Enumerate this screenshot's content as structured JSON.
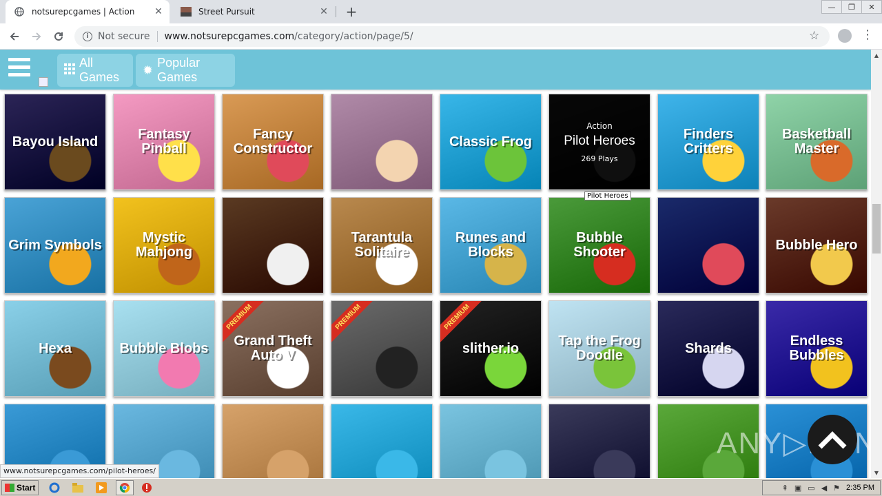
{
  "browser": {
    "tabs": [
      {
        "title": "notsurepcgames | Action",
        "active": true
      },
      {
        "title": "Street Pursuit",
        "active": false
      }
    ],
    "new_tab": "+",
    "close": "✕",
    "window_controls": [
      "—",
      "❐",
      "✕"
    ],
    "security": "Not secure",
    "url_host": "www.notsurepcgames.com",
    "url_path": "/category/action/page/5/",
    "status_url": "www.notsurepcgames.com/pilot-heroes/"
  },
  "site": {
    "nav": {
      "all_games": "All Games",
      "popular_games": "Popular Games"
    },
    "premium_label": "PREMIUM",
    "watermark": "ANY▷RUN",
    "hover": {
      "category": "Action",
      "name": "Pilot Heroes",
      "plays": "269 Plays",
      "tooltip": "Pilot Heroes"
    },
    "games": [
      {
        "name": "",
        "color": "#2ea0d6",
        "accent": "#f2c94c"
      },
      {
        "name": "",
        "color": "#3b3f4a",
        "accent": "#7bd13a"
      },
      {
        "name": "",
        "color": "#a8d67a",
        "accent": "#e8b14a"
      },
      {
        "name": "",
        "color": "#2667c9",
        "accent": "#9b3fd6"
      },
      {
        "name": "",
        "color": "#25b7e0",
        "accent": "#ff9c1a"
      },
      {
        "name": "",
        "color": "#1f8fd6",
        "accent": "#f2c94c"
      },
      {
        "name": "",
        "color": "#c85a2a",
        "accent": "#3a2a1a"
      },
      {
        "name": "",
        "color": "#f4a21e",
        "accent": "#7a3a12"
      },
      {
        "name": "Bayou Island",
        "color": "#2b2456",
        "accent": "#6a4a1e"
      },
      {
        "name": "Fantasy Pinball",
        "color": "#f49ac2",
        "accent": "#ffe04a"
      },
      {
        "name": "Fancy Constructor",
        "color": "#d99a55",
        "accent": "#e04a5a"
      },
      {
        "name": "",
        "color": "#b08aa8",
        "accent": "#f3d4b0"
      },
      {
        "name": "Classic Frog",
        "color": "#38b6e8",
        "accent": "#6cc43a"
      },
      {
        "name": "Pilot Heroes",
        "color": "#2a2a2a",
        "accent": "#555"
      },
      {
        "name": "Finders Critters",
        "color": "#3fb4ea",
        "accent": "#ffd23a"
      },
      {
        "name": "Basketball Master",
        "color": "#8fd3a8",
        "accent": "#d96a2a"
      },
      {
        "name": "Grim Symbols",
        "color": "#4aa3d6",
        "accent": "#f2a81e"
      },
      {
        "name": "Mystic Mahjong",
        "color": "#f2c21e",
        "accent": "#c0651a"
      },
      {
        "name": "",
        "color": "#5a3a22",
        "accent": "#f0f0f0"
      },
      {
        "name": "Tarantula Solitaire",
        "color": "#b9894e",
        "accent": "#ffffff"
      },
      {
        "name": "Runes and Blocks",
        "color": "#5ab8e6",
        "accent": "#d6b44a"
      },
      {
        "name": "Bubble Shooter",
        "color": "#4a9a3a",
        "accent": "#d62d20"
      },
      {
        "name": "",
        "color": "#1a2a6a",
        "accent": "#e04a5a"
      },
      {
        "name": "Bubble Hero",
        "color": "#6a3a2a",
        "accent": "#f2c94c"
      },
      {
        "name": "Hexa",
        "color": "#8ad0e8",
        "accent": "#7a4a1e"
      },
      {
        "name": "Bubble Blobs",
        "color": "#a8e0f0",
        "accent": "#f27ab0"
      },
      {
        "name": "Grand Theft Auto V",
        "color": "#8a7060",
        "accent": "#ffffff",
        "premium": true
      },
      {
        "name": "",
        "color": "#6a6a6a",
        "accent": "#222",
        "premium": true
      },
      {
        "name": "slither.io",
        "color": "#222222",
        "accent": "#7ad63a",
        "premium": true
      },
      {
        "name": "Tap the Frog Doodle",
        "color": "#bfe3f2",
        "accent": "#7ac43a"
      },
      {
        "name": "Shards",
        "color": "#2a2a5a",
        "accent": "#d6d6f0"
      },
      {
        "name": "Endless Bubbles",
        "color": "#3a2aa8",
        "accent": "#f2c21e"
      },
      {
        "name": "",
        "color": "#3a9ad6",
        "accent": ""
      },
      {
        "name": "",
        "color": "#6ab8e0",
        "accent": ""
      },
      {
        "name": "",
        "color": "#d6a26a",
        "accent": ""
      },
      {
        "name": "",
        "color": "#3ab8e8",
        "accent": ""
      },
      {
        "name": "",
        "color": "#7ac4e0",
        "accent": ""
      },
      {
        "name": "",
        "color": "#3a3a5a",
        "accent": ""
      },
      {
        "name": "",
        "color": "#5aa83a",
        "accent": ""
      },
      {
        "name": "",
        "color": "#2a90d6",
        "accent": ""
      }
    ]
  },
  "taskbar": {
    "start": "Start",
    "clock": "2:35 PM"
  }
}
